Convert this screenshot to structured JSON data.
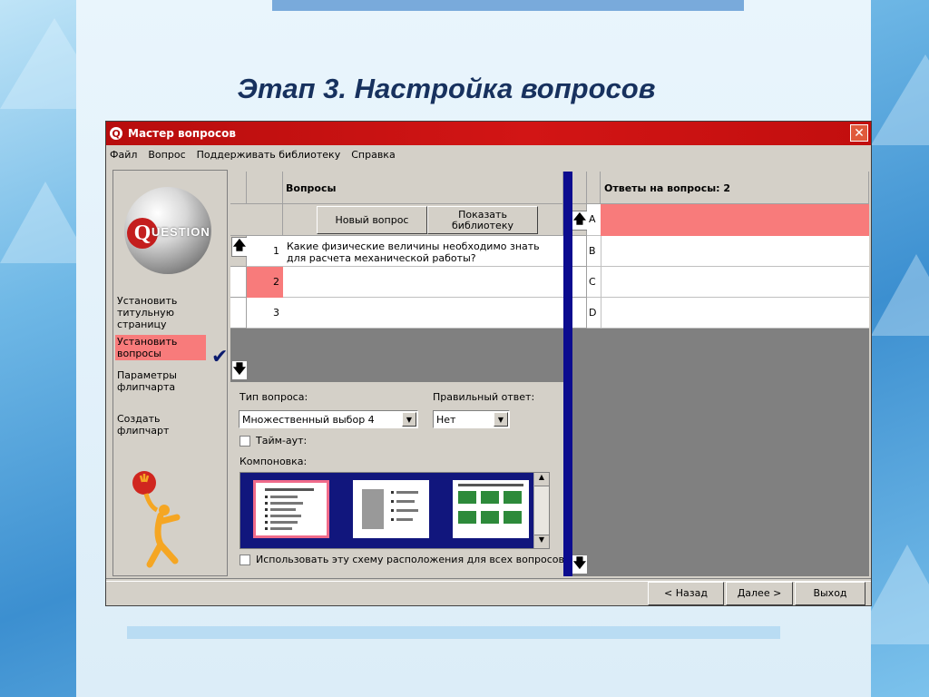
{
  "slide": {
    "title": "Этап 3. Настройка вопросов"
  },
  "window": {
    "title": "Мастер вопросов",
    "close": "✕",
    "menu": [
      "Файл",
      "Вопрос",
      "Поддерживать библиотеку",
      "Справка"
    ]
  },
  "sidebar": {
    "logo_letter": "Q",
    "logo_text": "UESTION",
    "steps": [
      {
        "label": "Установить титульную страницу",
        "done": true
      },
      {
        "label": "Установить вопросы",
        "active": true
      },
      {
        "label": "Параметры флипчарта"
      },
      {
        "label": "Создать флипчарт"
      }
    ],
    "check_icon": "✔"
  },
  "questions": {
    "header": "Вопросы",
    "new_button": "Новый вопрос",
    "library_button": "Показать библиотеку",
    "rows": [
      {
        "num": "1",
        "text": "Какие физические величины необходимо знать для расчета механической работы?"
      },
      {
        "num": "2",
        "text": ""
      },
      {
        "num": "3",
        "text": ""
      }
    ],
    "up_icon": "🡅",
    "down_icon": "🡇"
  },
  "answers": {
    "header": "Ответы на вопросы: 2",
    "rows": [
      {
        "letter": "A"
      },
      {
        "letter": "B"
      },
      {
        "letter": "C"
      },
      {
        "letter": "D"
      }
    ]
  },
  "settings": {
    "type_label": "Тип вопроса:",
    "type_value": "Множественный выбор 4",
    "correct_label": "Правильный ответ:",
    "correct_value": "Нет",
    "timeout_label": "Тайм-аут:",
    "layout_label": "Компоновка:",
    "use_for_all_label": "Использовать эту схему расположения для всех вопросов"
  },
  "footer": {
    "back": "< Назад",
    "next": "Далее >",
    "exit": "Выход"
  },
  "colors": {
    "title_red": "#c0100f",
    "highlight": "#f87b7b",
    "divider": "#0c0c8f"
  }
}
